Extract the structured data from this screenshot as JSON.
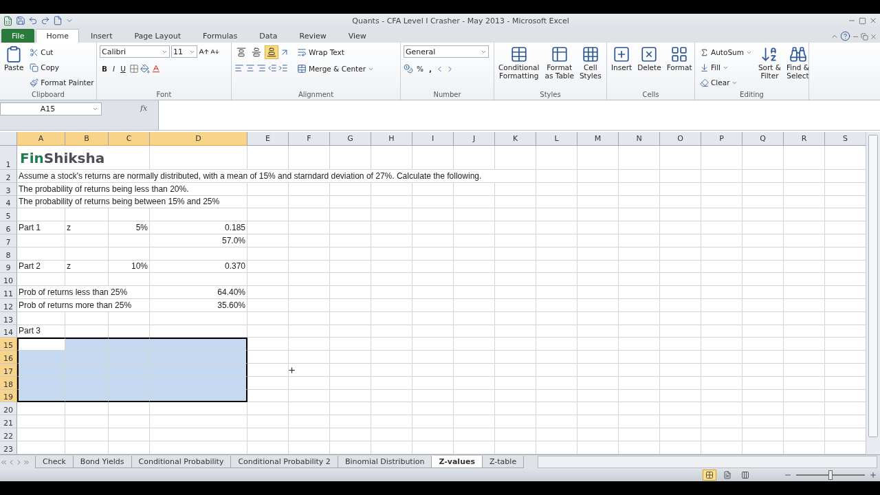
{
  "window": {
    "title": "Quants - CFA Level I Crasher - May 2013  -  Microsoft Excel"
  },
  "ribbon_tabs": [
    {
      "label": "File",
      "kind": "file",
      "selected": false
    },
    {
      "label": "Home",
      "kind": "tab",
      "selected": true
    },
    {
      "label": "Insert",
      "kind": "tab",
      "selected": false
    },
    {
      "label": "Page Layout",
      "kind": "tab",
      "selected": false
    },
    {
      "label": "Formulas",
      "kind": "tab",
      "selected": false
    },
    {
      "label": "Data",
      "kind": "tab",
      "selected": false
    },
    {
      "label": "Review",
      "kind": "tab",
      "selected": false
    },
    {
      "label": "View",
      "kind": "tab",
      "selected": false
    }
  ],
  "ribbon": {
    "clipboard": {
      "label": "Clipboard",
      "paste": "Paste",
      "cut": "Cut",
      "copy": "Copy",
      "format_painter": "Format Painter"
    },
    "font": {
      "label": "Font",
      "font_name": "Calibri",
      "font_size": "11",
      "bold": "B",
      "italic": "I",
      "underline": "U"
    },
    "alignment": {
      "label": "Alignment",
      "vertical_align": [
        {
          "selected": false
        },
        {
          "selected": false
        },
        {
          "selected": true
        }
      ],
      "wrap_text": "Wrap Text",
      "merge_center": "Merge & Center"
    },
    "number": {
      "label": "Number",
      "format": "General",
      "percent": "%",
      "comma": ","
    },
    "styles": {
      "label": "Styles",
      "buttons": [
        [
          "Conditional",
          "Formatting"
        ],
        [
          "Format",
          "as Table"
        ],
        [
          "Cell",
          "Styles"
        ]
      ]
    },
    "cells": {
      "label": "Cells",
      "buttons": [
        "Insert",
        "Delete",
        "Format"
      ]
    },
    "editing": {
      "label": "Editing",
      "autosum": "AutoSum",
      "fill": "Fill",
      "clear": "Clear",
      "sort": [
        "Sort &",
        "Filter"
      ],
      "find": [
        "Find &",
        "Select"
      ]
    }
  },
  "formula_bar": {
    "name_box": "A15",
    "fx": "fx"
  },
  "columns": [
    {
      "label": "A",
      "selected": true
    },
    {
      "label": "B",
      "selected": true
    },
    {
      "label": "C",
      "selected": true
    },
    {
      "label": "D",
      "selected": true
    },
    {
      "label": "E",
      "selected": false
    },
    {
      "label": "F",
      "selected": false
    },
    {
      "label": "G",
      "selected": false
    },
    {
      "label": "H",
      "selected": false
    },
    {
      "label": "I",
      "selected": false
    },
    {
      "label": "J",
      "selected": false
    },
    {
      "label": "K",
      "selected": false
    },
    {
      "label": "L",
      "selected": false
    },
    {
      "label": "M",
      "selected": false
    },
    {
      "label": "N",
      "selected": false
    },
    {
      "label": "O",
      "selected": false
    },
    {
      "label": "P",
      "selected": false
    },
    {
      "label": "Q",
      "selected": false
    },
    {
      "label": "R",
      "selected": false
    },
    {
      "label": "S",
      "selected": false
    }
  ],
  "rows": [
    {
      "number": "1",
      "selected": false,
      "cells": [
        {
          "kind": "logo",
          "parts": [
            {
              "text": "Fin",
              "color": "#1e7d4f"
            },
            {
              "text": "Shiksha",
              "color": "#4b4f54"
            }
          ]
        }
      ]
    },
    {
      "number": "2",
      "selected": false,
      "cells": [
        {
          "kind": "text",
          "text": "Assume a stock's returns are normally distributed, with a mean of 15% and starndard deviation of 27%. Calculate the following."
        }
      ]
    },
    {
      "number": "3",
      "selected": false,
      "cells": [
        {
          "kind": "text",
          "text": "The probability of returns being less than 20%."
        }
      ]
    },
    {
      "number": "4",
      "selected": false,
      "cells": [
        {
          "kind": "text",
          "text": "The probability of returns being between 15% and 25%"
        }
      ]
    },
    {
      "number": "5",
      "selected": false,
      "cells": []
    },
    {
      "number": "6",
      "selected": false,
      "cells": [
        {
          "kind": "text",
          "text": "Part 1"
        },
        {
          "kind": "text",
          "text": "z"
        },
        {
          "kind": "number",
          "text": "5%"
        },
        {
          "kind": "number",
          "text": "0.185"
        }
      ]
    },
    {
      "number": "7",
      "selected": false,
      "cells": [
        {},
        {},
        {},
        {
          "kind": "number",
          "text": "57.0%"
        }
      ]
    },
    {
      "number": "8",
      "selected": false,
      "cells": []
    },
    {
      "number": "9",
      "selected": false,
      "cells": [
        {
          "kind": "text",
          "text": "Part 2"
        },
        {
          "kind": "text",
          "text": "z"
        },
        {
          "kind": "number",
          "text": "10%"
        },
        {
          "kind": "number",
          "text": "0.370"
        }
      ]
    },
    {
      "number": "10",
      "selected": false,
      "cells": []
    },
    {
      "number": "11",
      "selected": false,
      "cells": [
        {
          "kind": "text",
          "text": "Prob of returns less than 25%"
        },
        {},
        {},
        {
          "kind": "number",
          "text": "64.40%"
        }
      ]
    },
    {
      "number": "12",
      "selected": false,
      "cells": [
        {
          "kind": "text",
          "text": "Prob of returns more than 25%"
        },
        {},
        {},
        {
          "kind": "number",
          "text": "35.60%"
        }
      ]
    },
    {
      "number": "13",
      "selected": false,
      "cells": []
    },
    {
      "number": "14",
      "selected": false,
      "cells": [
        {
          "kind": "text",
          "text": "Part 3"
        }
      ]
    },
    {
      "number": "15",
      "selected": true,
      "cells": []
    },
    {
      "number": "16",
      "selected": true,
      "cells": []
    },
    {
      "number": "17",
      "selected": true,
      "cells": []
    },
    {
      "number": "18",
      "selected": true,
      "cells": []
    },
    {
      "number": "19",
      "selected": true,
      "cells": []
    },
    {
      "number": "20",
      "selected": false,
      "cells": []
    },
    {
      "number": "21",
      "selected": false,
      "cells": []
    },
    {
      "number": "22",
      "selected": false,
      "cells": []
    },
    {
      "number": "23",
      "selected": false,
      "cells": []
    }
  ],
  "sheet_tabs": [
    {
      "label": "Check",
      "selected": false
    },
    {
      "label": "Bond Yields",
      "selected": false
    },
    {
      "label": "Conditional Probability",
      "selected": false
    },
    {
      "label": "Conditional Probability 2",
      "selected": false
    },
    {
      "label": "Binomial Distribution",
      "selected": false
    },
    {
      "label": "Z-values",
      "selected": true
    },
    {
      "label": "Z-table",
      "selected": false
    }
  ],
  "status_bar": {
    "views": [
      {
        "selected": true
      },
      {
        "selected": false
      },
      {
        "selected": false
      }
    ],
    "zoom": {
      "level": 0.5
    }
  }
}
